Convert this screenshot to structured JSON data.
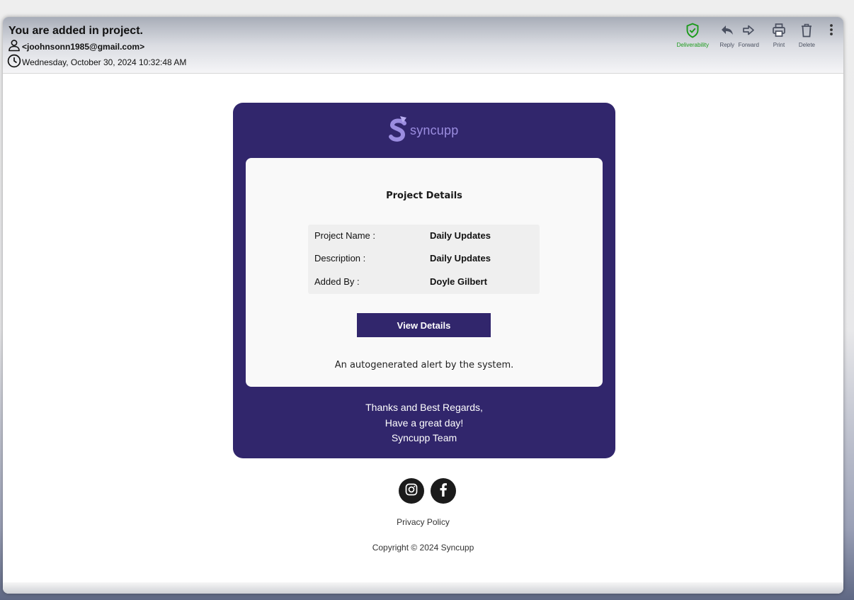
{
  "email": {
    "subject": "You are added in project.",
    "sender": "<joohnsonn1985@gmail.com>",
    "date": "Wednesday, October 30, 2024 10:32:48 AM"
  },
  "toolbar": {
    "deliverability": "Deliverability",
    "reply": "Reply",
    "forward": "Forward",
    "print": "Print",
    "delete": "Delete"
  },
  "colors": {
    "brand": "#31266c",
    "logo": "#9b8de0",
    "deliverability": "#1a9a1a"
  },
  "body": {
    "logo_text": "syncupp",
    "title": "Project Details",
    "details": [
      {
        "label": "Project Name :",
        "value": "Daily Updates"
      },
      {
        "label": "Description :",
        "value": "Daily Updates"
      },
      {
        "label": "Added By :",
        "value": "Doyle Gilbert"
      }
    ],
    "button": "View Details",
    "autogen": "An autogenerated alert by the system.",
    "regards": [
      "Thanks and Best Regards,",
      "Have a great day!",
      "Syncupp Team"
    ]
  },
  "footer": {
    "socials": [
      "instagram-icon",
      "facebook-icon"
    ],
    "privacy": "Privacy Policy",
    "copyright": "Copyright © 2024 Syncupp"
  }
}
